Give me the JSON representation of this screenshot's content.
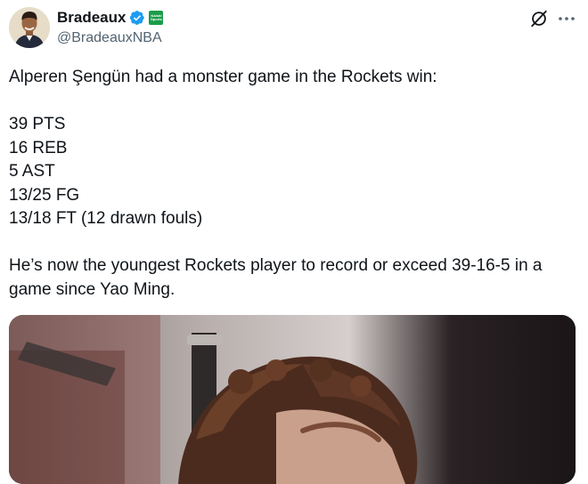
{
  "author": {
    "display_name": "Bradeaux",
    "handle": "@BradeauxNBA",
    "affiliate_badge_text": "Kalshi Sports"
  },
  "tweet": {
    "text": "Alperen Şengün had a monster game in the Rockets win:\n\n39 PTS\n16 REB\n5 AST\n13/25 FG\n13/18 FT (12 drawn fouls)\n\nHe’s now the youngest Rockets player to record or exceed 39-16-5 in a game since Yao Ming."
  },
  "icons": {
    "verified": "verified-badge-icon",
    "grok": "grok-icon",
    "more": "more-options-icon"
  },
  "colors": {
    "verified": "#1d9bf0",
    "affiliate_badge": "#1a9c4a",
    "handle": "#536471"
  }
}
